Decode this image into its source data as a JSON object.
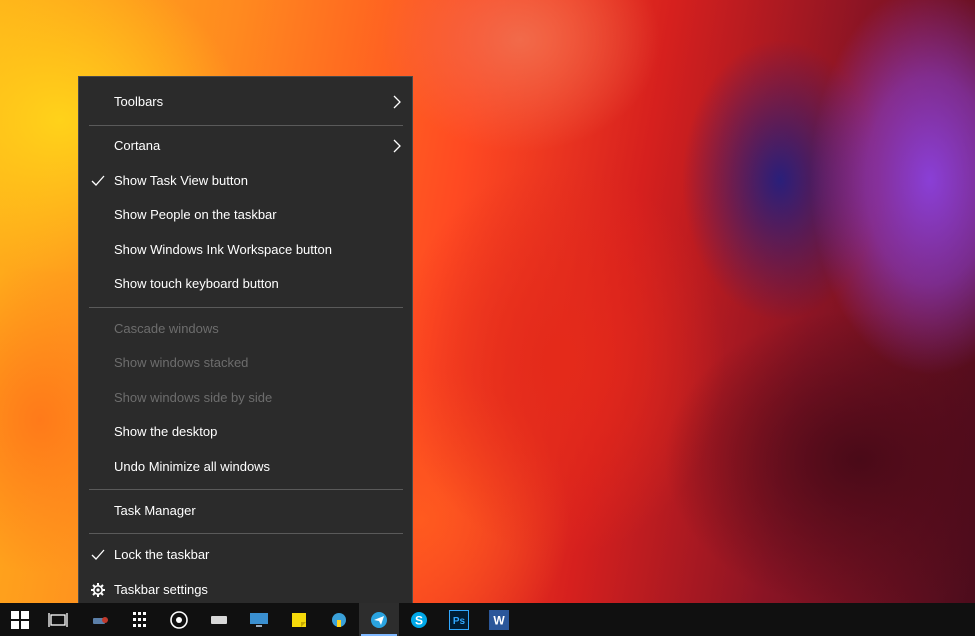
{
  "context_menu": {
    "items": [
      {
        "label": "Toolbars",
        "has_submenu": true
      },
      {
        "label": "Cortana",
        "has_submenu": true
      },
      {
        "label": "Show Task View button",
        "checked": true
      },
      {
        "label": "Show People on the taskbar"
      },
      {
        "label": "Show Windows Ink Workspace button"
      },
      {
        "label": "Show touch keyboard button"
      },
      {
        "label": "Cascade windows",
        "disabled": true
      },
      {
        "label": "Show windows stacked",
        "disabled": true
      },
      {
        "label": "Show windows side by side",
        "disabled": true
      },
      {
        "label": "Show the desktop"
      },
      {
        "label": "Undo Minimize all windows"
      },
      {
        "label": "Task Manager"
      },
      {
        "label": "Lock the taskbar",
        "checked": true
      },
      {
        "label": "Taskbar settings",
        "icon": "gear-icon"
      }
    ]
  },
  "taskbar": {
    "icons": [
      {
        "name": "start-icon"
      },
      {
        "name": "task-view-icon"
      },
      {
        "name": "tools-icon"
      },
      {
        "name": "calculator-icon"
      },
      {
        "name": "media-icon"
      },
      {
        "name": "drive-icon"
      },
      {
        "name": "monitor-icon"
      },
      {
        "name": "sticky-notes-icon"
      },
      {
        "name": "network-icon"
      },
      {
        "name": "telegram-icon",
        "active": true
      },
      {
        "name": "skype-icon",
        "text": "S"
      },
      {
        "name": "photoshop-icon",
        "text": "Ps"
      },
      {
        "name": "word-icon",
        "text": "W"
      }
    ]
  },
  "colors": {
    "menu_background": "#2b2b2b",
    "menu_text": "#ffffff",
    "menu_disabled_text": "#6d6d6d",
    "taskbar_background": "#101010"
  }
}
